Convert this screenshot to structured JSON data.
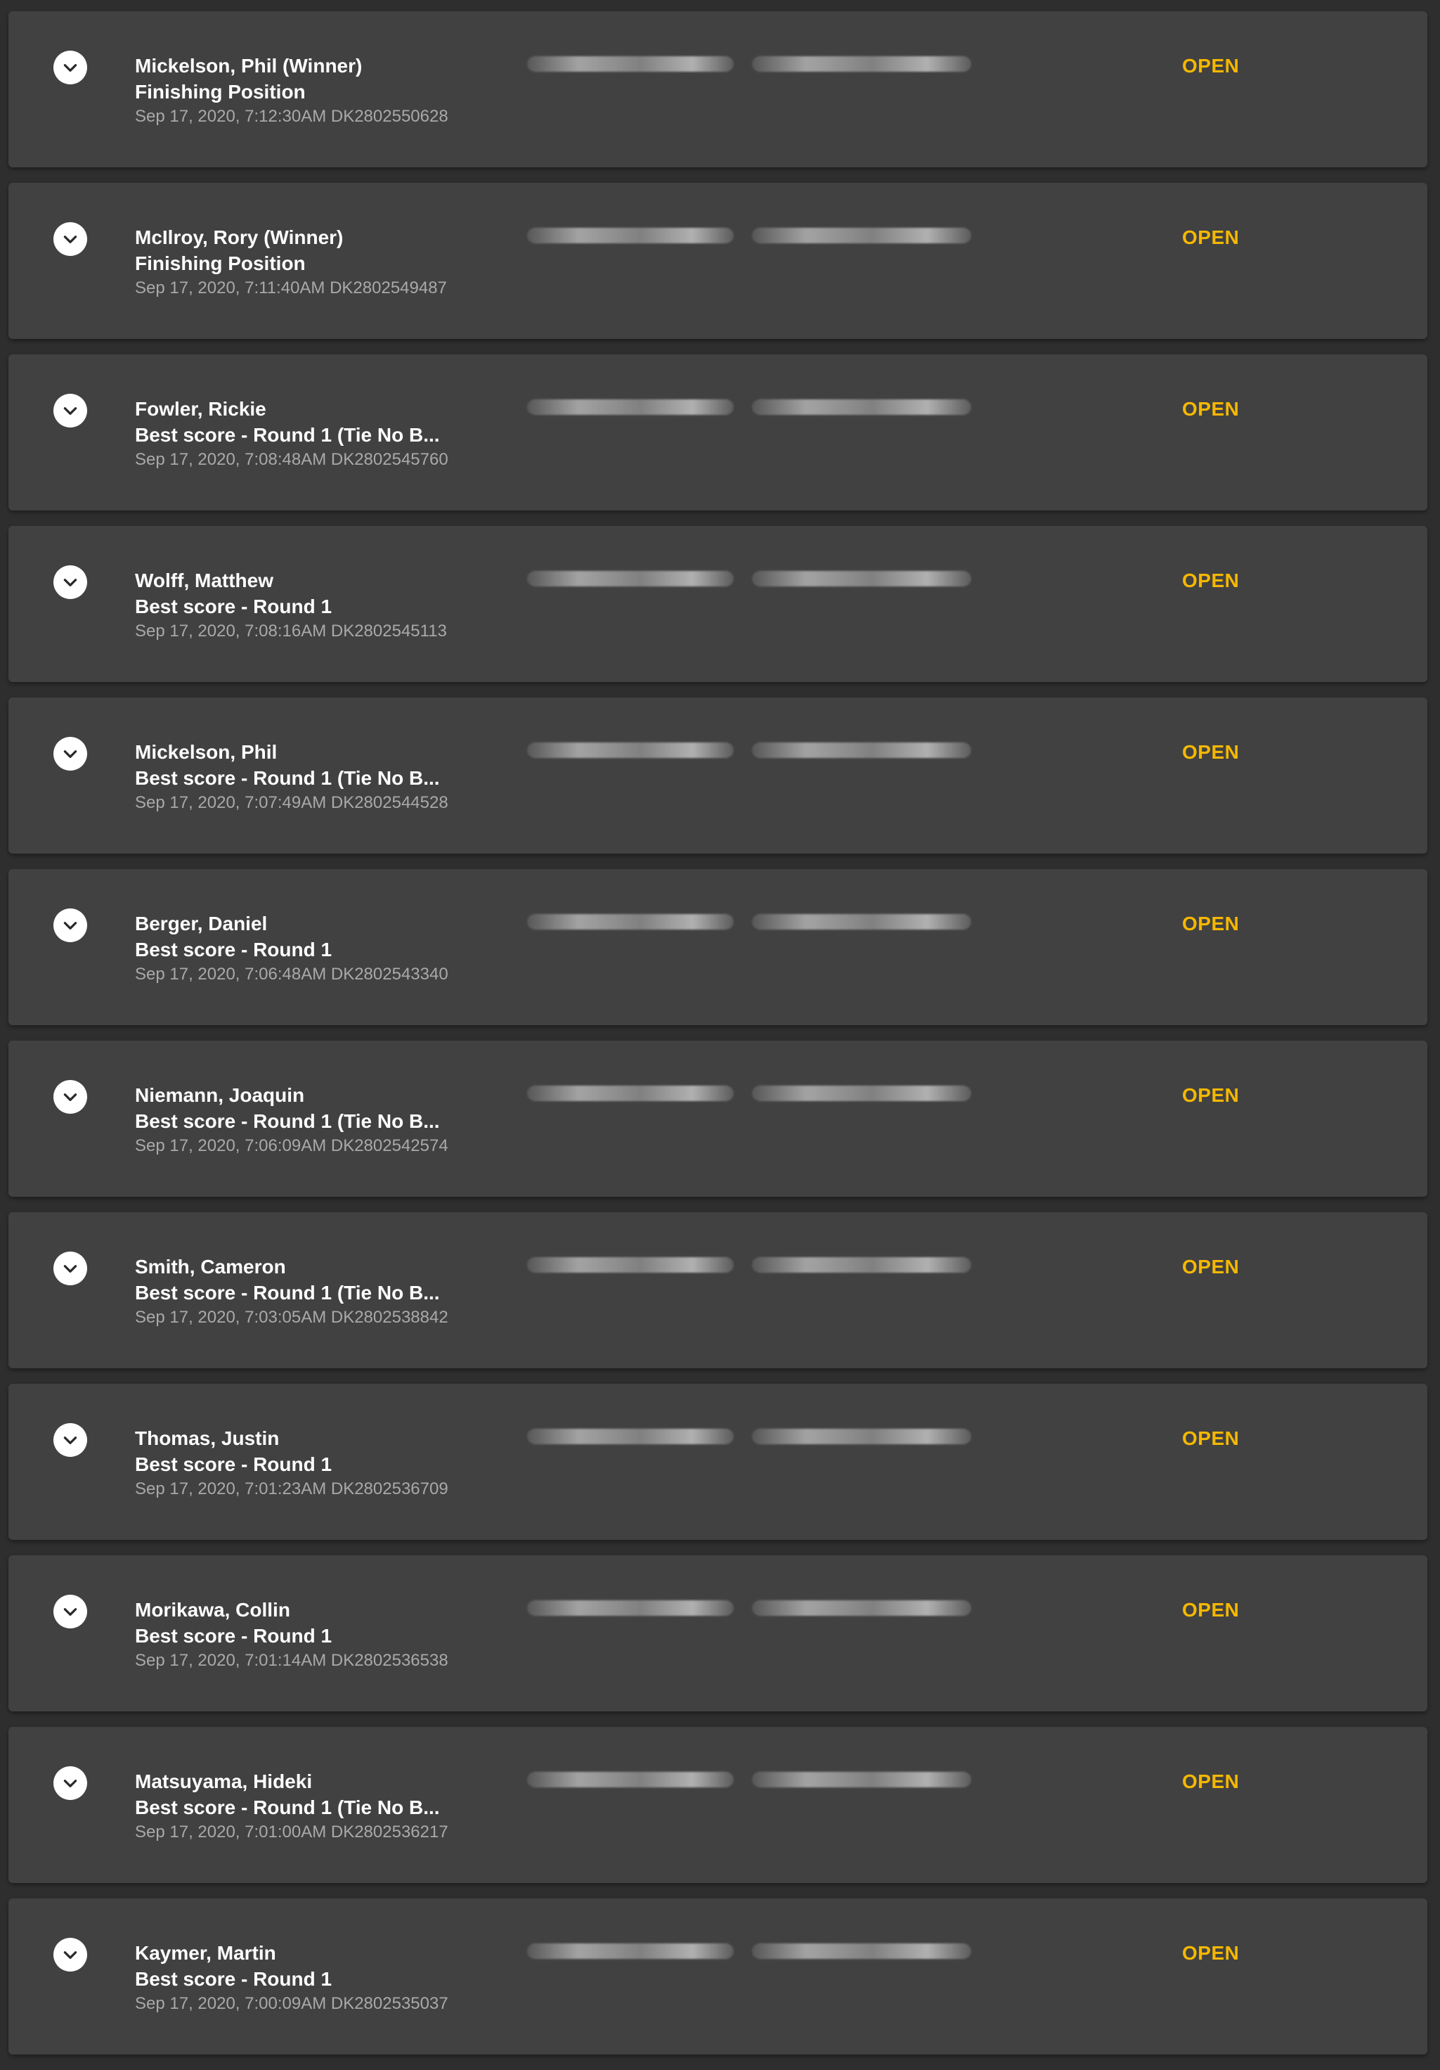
{
  "bets": [
    {
      "player": "Mickelson, Phil (Winner)",
      "market": "Finishing Position",
      "meta": "Sep 17, 2020, 7:12:30AM DK2802550628",
      "status": "OPEN"
    },
    {
      "player": "McIlroy, Rory (Winner)",
      "market": "Finishing Position",
      "meta": "Sep 17, 2020, 7:11:40AM DK2802549487",
      "status": "OPEN"
    },
    {
      "player": "Fowler, Rickie",
      "market": "Best score - Round 1 (Tie No B...",
      "meta": "Sep 17, 2020, 7:08:48AM DK2802545760",
      "status": "OPEN"
    },
    {
      "player": "Wolff, Matthew",
      "market": "Best score - Round 1",
      "meta": "Sep 17, 2020, 7:08:16AM DK2802545113",
      "status": "OPEN"
    },
    {
      "player": "Mickelson, Phil",
      "market": "Best score - Round 1 (Tie No B...",
      "meta": "Sep 17, 2020, 7:07:49AM DK2802544528",
      "status": "OPEN"
    },
    {
      "player": "Berger, Daniel",
      "market": "Best score - Round 1",
      "meta": "Sep 17, 2020, 7:06:48AM DK2802543340",
      "status": "OPEN"
    },
    {
      "player": "Niemann, Joaquin",
      "market": "Best score - Round 1 (Tie No B...",
      "meta": "Sep 17, 2020, 7:06:09AM DK2802542574",
      "status": "OPEN"
    },
    {
      "player": "Smith, Cameron",
      "market": "Best score - Round 1 (Tie No B...",
      "meta": "Sep 17, 2020, 7:03:05AM DK2802538842",
      "status": "OPEN"
    },
    {
      "player": "Thomas, Justin",
      "market": "Best score - Round 1",
      "meta": "Sep 17, 2020, 7:01:23AM DK2802536709",
      "status": "OPEN"
    },
    {
      "player": "Morikawa, Collin",
      "market": "Best score - Round 1",
      "meta": "Sep 17, 2020, 7:01:14AM DK2802536538",
      "status": "OPEN"
    },
    {
      "player": "Matsuyama, Hideki",
      "market": "Best score - Round 1 (Tie No B...",
      "meta": "Sep 17, 2020, 7:01:00AM DK2802536217",
      "status": "OPEN"
    },
    {
      "player": "Kaymer, Martin",
      "market": "Best score - Round 1",
      "meta": "Sep 17, 2020, 7:00:09AM DK2802535037",
      "status": "OPEN"
    }
  ],
  "colors": {
    "background": "#2e2e2e",
    "card": "#414141",
    "status_open": "#f5b800",
    "meta_text": "#a9a9a9"
  },
  "icons": {
    "expand": "chevron-down-icon"
  }
}
